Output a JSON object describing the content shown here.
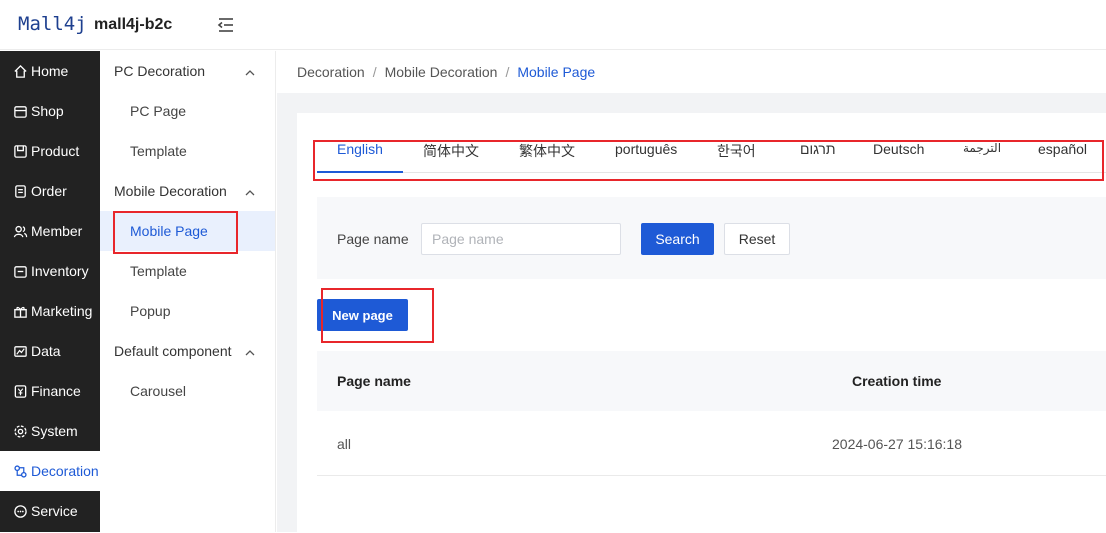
{
  "header": {
    "logo": "Mall4j",
    "brand": "mall4j-b2c",
    "collapse_icon": "menu-fold-icon"
  },
  "sidebar": {
    "items": [
      {
        "label": "Home",
        "icon": "home-icon"
      },
      {
        "label": "Shop",
        "icon": "shop-icon"
      },
      {
        "label": "Product",
        "icon": "product-icon"
      },
      {
        "label": "Order",
        "icon": "order-icon"
      },
      {
        "label": "Member",
        "icon": "member-icon"
      },
      {
        "label": "Inventory",
        "icon": "inventory-icon"
      },
      {
        "label": "Marketing",
        "icon": "gift-icon"
      },
      {
        "label": "Data",
        "icon": "chart-icon"
      },
      {
        "label": "Finance",
        "icon": "finance-icon"
      },
      {
        "label": "System",
        "icon": "gear-icon"
      },
      {
        "label": "Decoration",
        "icon": "decoration-icon"
      },
      {
        "label": "Service",
        "icon": "chat-icon"
      }
    ],
    "active": "Decoration"
  },
  "subnav": {
    "groups": [
      {
        "label": "PC Decoration",
        "items": [
          "PC Page",
          "Template"
        ]
      },
      {
        "label": "Mobile Decoration",
        "items": [
          "Mobile Page",
          "Template",
          "Popup"
        ]
      },
      {
        "label": "Default component",
        "items": [
          "Carousel"
        ]
      }
    ],
    "active": "Mobile Page"
  },
  "breadcrumb": [
    "Decoration",
    "Mobile Decoration",
    "Mobile Page"
  ],
  "language_tabs": [
    "English",
    "简体中文",
    "繁体中文",
    "português",
    "한국어",
    "תרגום",
    "Deutsch",
    "الترجمة",
    "español"
  ],
  "active_tab": "English",
  "search": {
    "label": "Page name",
    "placeholder": "Page name",
    "value": "",
    "search_label": "Search",
    "reset_label": "Reset"
  },
  "new_page_label": "New page",
  "table": {
    "columns": [
      "Page name",
      "Creation time"
    ],
    "rows": [
      [
        "all",
        "2024-06-27 15:16:18"
      ]
    ]
  },
  "colors": {
    "primary": "#1e5ad6",
    "sidebar_bg": "#222222",
    "annotation": "#e8262b"
  }
}
